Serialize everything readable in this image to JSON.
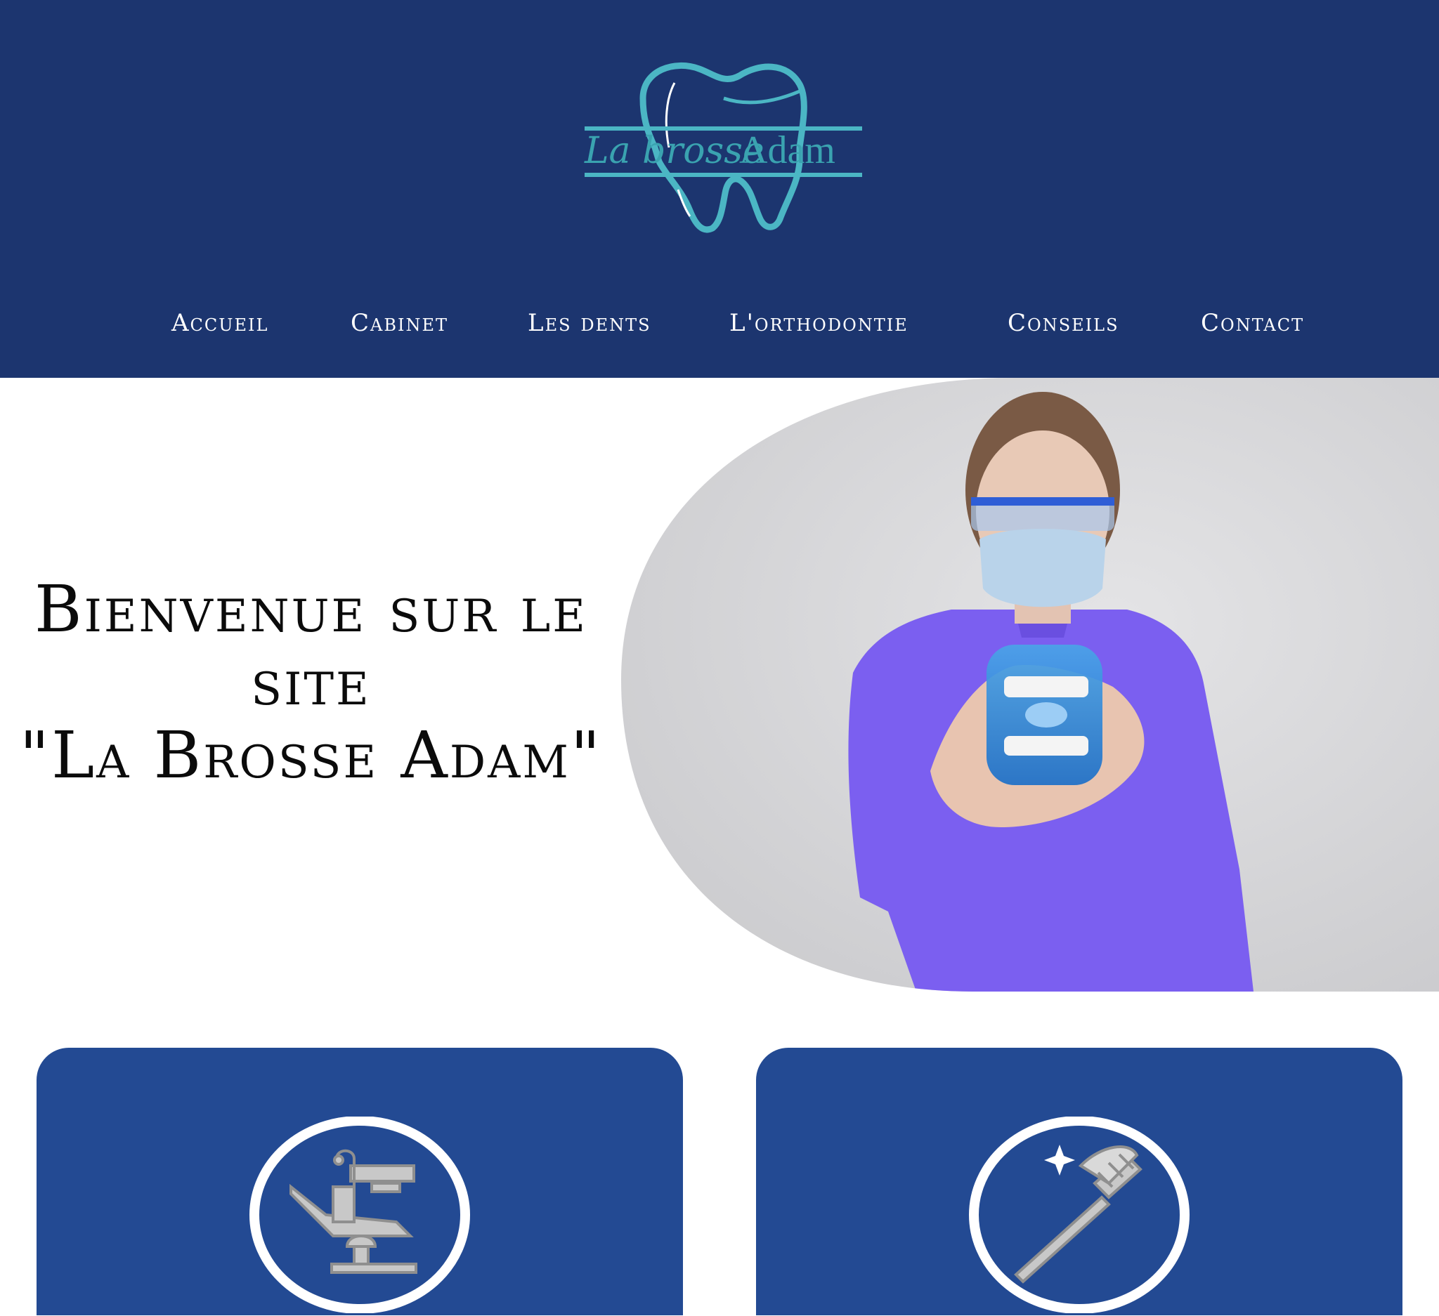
{
  "logo": {
    "text_script": "La brosse",
    "text_name": "Adam",
    "icon": "tooth-logo-icon"
  },
  "nav": {
    "items": [
      {
        "label": "Accueil"
      },
      {
        "label": "Cabinet"
      },
      {
        "label": "Les dents"
      },
      {
        "label": "L'orthodontie"
      },
      {
        "label": "Conseils"
      },
      {
        "label": "Contact"
      }
    ]
  },
  "hero": {
    "title_line1": "Bienvenue sur le",
    "title_line2": "site",
    "title_line3": "\"La Brosse Adam\"",
    "image": "dentist-holding-dental-model-photo"
  },
  "cards": [
    {
      "icon": "dental-chair-icon"
    },
    {
      "icon": "toothbrush-icon"
    }
  ],
  "colors": {
    "header_bg": "#1c356f",
    "card_bg": "#234a93",
    "logo_accent": "#4bb6c4",
    "nav_text": "#ffffff",
    "title_text": "#0b0b0b"
  }
}
